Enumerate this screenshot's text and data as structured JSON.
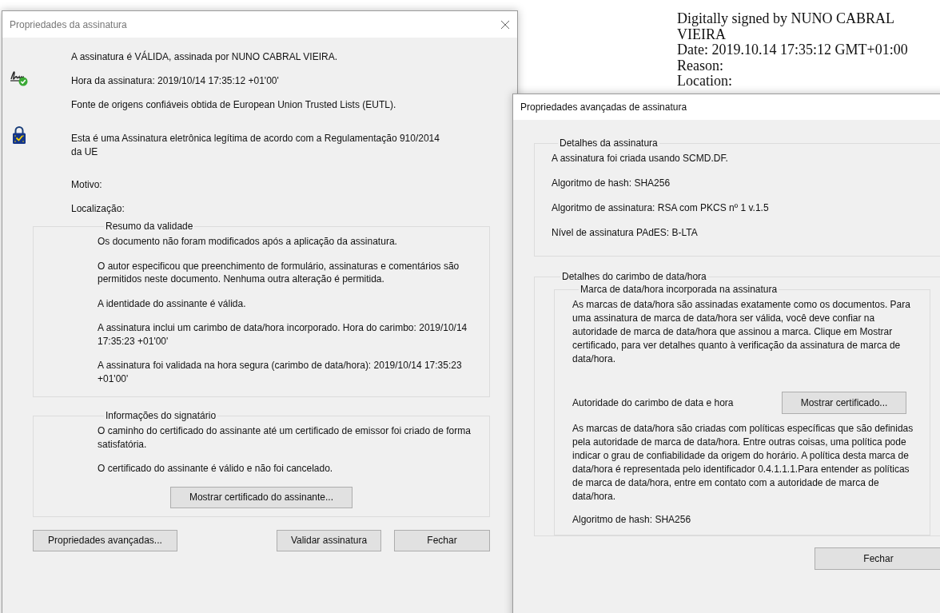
{
  "desktop_text": {
    "lines": [
      "Digitally signed by NUNO CABRAL",
      "VIEIRA",
      "Date: 2019.10.14 17:35:12 GMT+01:00",
      "Reason:",
      "Location:"
    ]
  },
  "signature_properties": {
    "title": "Propriedades da assinatura",
    "status_items": [
      {
        "kind": "signature",
        "texts": [
          "A assinatura é VÁLIDA, assinada por NUNO CABRAL VIEIRA.",
          "Hora da assinatura:  2019/10/14 17:35:12 +01'00'",
          "Fonte de origens confiáveis obtida de European Union Trusted Lists (EUTL)."
        ]
      },
      {
        "kind": "eu-lock",
        "texts": [
          "Esta é uma Assinatura eletrônica legítima de acordo com a Regulamentação 910/2014 da UE"
        ]
      }
    ],
    "fields": [
      "Motivo:",
      "Localização:"
    ],
    "groups": [
      {
        "legend": "Resumo da validade",
        "paragraphs": [
          "Os documento não foram modificados após a aplicação da assinatura.",
          "O autor especificou que preenchimento de formulário, assinaturas e comentários são permitidos neste documento. Nenhuma outra alteração é permitida.",
          "A identidade do assinante é válida.",
          "A assinatura inclui um carimbo de data/hora incorporado. Hora do carimbo: 2019/10/14 17:35:23 +01'00'",
          "A assinatura foi validada na hora segura (carimbo de data/hora): 2019/10/14 17:35:23 +01'00'"
        ]
      },
      {
        "legend": "Informações do signatário",
        "paragraphs": [
          "O caminho do certificado do assinante até um certificado de emissor foi criado de forma satisfatória.",
          "O certificado do assinante é válido e não foi cancelado."
        ],
        "button": "Mostrar certificado do assinante..."
      }
    ],
    "buttons": [
      "Propriedades avançadas...",
      "Validar assinatura",
      "Fechar"
    ]
  },
  "advanced_properties": {
    "title": "Propriedades avançadas de assinatura",
    "details": {
      "legend": "Detalhes da assinatura",
      "lines": [
        "A assinatura foi criada usando SCMD.DF.",
        "Algoritmo de hash: SHA256",
        "Algoritmo de assinatura: RSA com PKCS nº 1 v.1.5",
        "Nível de assinatura PAdES: B-LTA"
      ]
    },
    "timestamp": {
      "legend": "Detalhes do carimbo de data/hora",
      "subgroup": {
        "legend": "Marca de data/hora incorporada na assinatura",
        "intro": "As marcas de data/hora são assinadas exatamente como os documentos. Para uma assinatura de marca de data/hora ser válida, você deve confiar na autoridade de marca de data/hora que assinou a marca. Clique em Mostrar certificado, para ver detalhes quanto à verificação da assinatura de marca de data/hora.",
        "authority_label": "Autoridade do carimbo de data e hora",
        "authority_button": "Mostrar certificado...",
        "policy": "As marcas de data/hora são criadas com políticas específicas que são definidas pela autoridade de marca de data/hora. Entre outras coisas, uma política pode indicar o grau de confiabilidade da origem do horário. A política desta marca de data/hora é representada pelo identificador 0.4.1.1.1.Para entender as políticas de marca de data/hora, entre em contato com a autoridade de marca de data/hora.",
        "hash": "Algoritmo de hash: SHA256"
      }
    },
    "buttons": [
      "Fechar"
    ]
  }
}
